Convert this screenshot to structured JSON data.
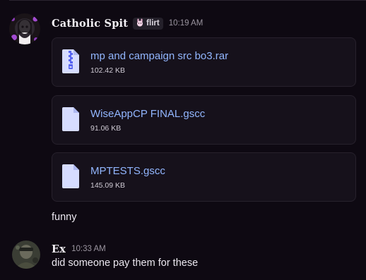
{
  "messages": [
    {
      "author": "Catholic Spit",
      "tag": {
        "icon": "bunny-icon",
        "label": "flirt"
      },
      "timestamp": "10:19 AM",
      "attachments": [
        {
          "icon": "zip-file-icon",
          "name": "mp and campaign src bo3.rar",
          "size": "102.42 KB"
        },
        {
          "icon": "file-icon",
          "name": "WiseAppCP FINAL.gscc",
          "size": "91.06 KB"
        },
        {
          "icon": "file-icon",
          "name": "MPTESTS.gscc",
          "size": "145.09 KB"
        }
      ],
      "text": "funny"
    },
    {
      "author": "Ex",
      "timestamp": "10:33 AM",
      "text": "did someone pay them for these"
    }
  ],
  "colors": {
    "background": "#0e0912",
    "attachment_bg": "#16111b",
    "link": "#92b6ff",
    "file_icon": "#d6dcff"
  }
}
